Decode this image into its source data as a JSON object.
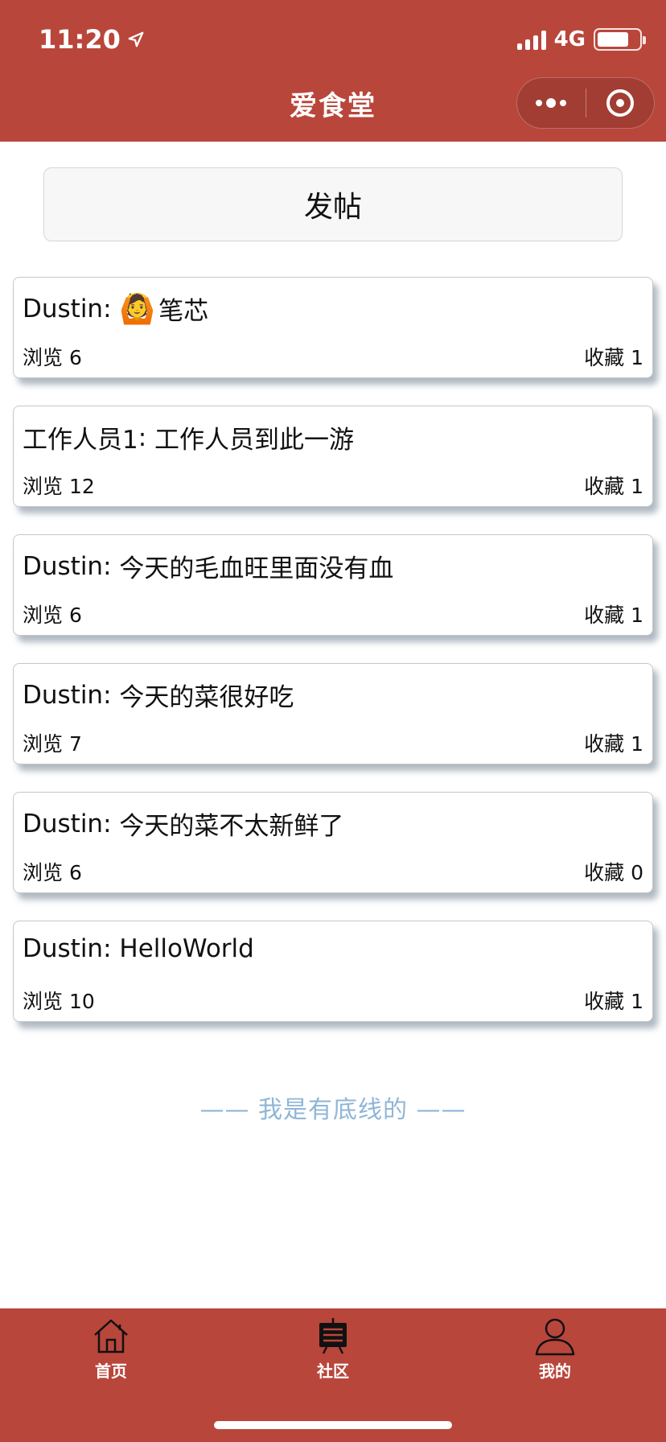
{
  "status_bar": {
    "time": "11:20",
    "network": "4G"
  },
  "header": {
    "title": "爱食堂"
  },
  "post_button": {
    "label": "发帖"
  },
  "posts": [
    {
      "author": "Dustin",
      "emoji": "🙆",
      "content": "笔芯",
      "views": "浏览 6",
      "favorites": "收藏 1"
    },
    {
      "author": "工作人员1",
      "emoji": "",
      "content": "工作人员到此一游",
      "views": "浏览 12",
      "favorites": "收藏 1"
    },
    {
      "author": "Dustin",
      "emoji": "",
      "content": "今天的毛血旺里面没有血",
      "views": "浏览 6",
      "favorites": "收藏 1"
    },
    {
      "author": "Dustin",
      "emoji": "",
      "content": "今天的菜很好吃",
      "views": "浏览 7",
      "favorites": "收藏 1"
    },
    {
      "author": "Dustin",
      "emoji": "",
      "content": "今天的菜不太新鲜了",
      "views": "浏览 6",
      "favorites": "收藏 0"
    },
    {
      "author": "Dustin",
      "emoji": "",
      "content": "HelloWorld",
      "views": "浏览 10",
      "favorites": "收藏 1"
    }
  ],
  "footer_text": "—— 我是有底线的 ——",
  "tabbar": {
    "items": [
      {
        "label": "首页",
        "icon": "home-icon"
      },
      {
        "label": "社区",
        "icon": "community-icon"
      },
      {
        "label": "我的",
        "icon": "profile-icon"
      }
    ]
  },
  "colors": {
    "brand": "#b9463b",
    "footer_text": "#8fb6d8"
  }
}
